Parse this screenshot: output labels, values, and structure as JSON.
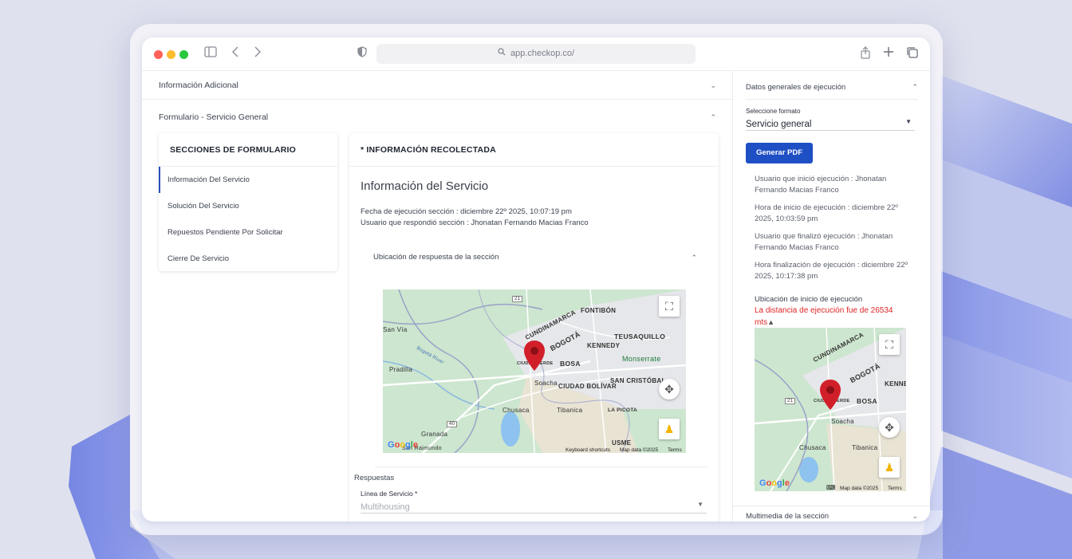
{
  "browser": {
    "url": "app.checkop.co/"
  },
  "main": {
    "accordion_additional": "Información Adicional",
    "accordion_form": "Formulario - Servicio General",
    "sections_card": {
      "title": "SECCIONES DE FORMULARIO",
      "items": [
        "Información Del Servicio",
        "Solución Del Servicio",
        "Repuestos Pendiente Por Solicitar",
        "Cierre De Servicio"
      ]
    },
    "info_card": {
      "title": "* INFORMACIÓN RECOLECTADA",
      "section_title": "Información del Servicio",
      "execution_date": "Fecha de ejecución sección : diciembre 22º 2025, 10:07:19 pm",
      "responder": "Usuario que respondió sección : Jhonatan Fernando Macias Franco",
      "location_label": "Ubicación de respuesta de la sección",
      "responses_label": "Respuestas",
      "field_label": "Línea de Servicio *",
      "field_value": "Multihousing"
    },
    "map1": {
      "labels": [
        "CUNDINAMARCA",
        "BOGOTÁ",
        "FONTIBÓN",
        "TEUSAQUILLO",
        "KENNEDY",
        "BOSA",
        "CIUDAD VERDE",
        "Monserrate",
        "CIUDAD BOLÍVAR",
        "SAN CRISTÓBAL",
        "LA PICOTA",
        "Soacha",
        "Chusaca",
        "Tibanica",
        "Pradilla",
        "Granada",
        "San Raimundo",
        "USME",
        "Bogotá River",
        "San Vía",
        "21",
        "40"
      ],
      "footer_shortcuts": "Keyboard shortcuts",
      "footer_data": "Map data ©2025",
      "footer_terms": "Terms"
    }
  },
  "right_panel": {
    "header": "Datos generales de ejecución",
    "format_label": "Seleccione formato",
    "format_value": "Servicio general",
    "pdf_button": "Generar PDF",
    "start_user": "Usuario que inició ejecución : Jhonatan Fernando Macias Franco",
    "start_time": "Hora de inicio de ejecución : diciembre 22º 2025, 10:03:59 pm",
    "end_user": "Usuario que finalizó ejecución : Jhonatan Fernando Macias Franco",
    "end_time": "Hora finalización de ejecución : diciembre 22º 2025, 10:17:38 pm",
    "start_location": "Ubicación de inicio de ejecución",
    "distance_warning": "La distancia de ejecución fue de 26534 mts",
    "multimedia": "Multimedia de la sección",
    "map2": {
      "labels": [
        "CUNDINAMARCA",
        "BOGOTÁ",
        "KENNE",
        "BOSA",
        "CIUDAD VERDE",
        "Soacha",
        "Chusaca",
        "Tibanica",
        "21"
      ],
      "footer_data": "Map data ©2025",
      "footer_terms": "Terms"
    }
  },
  "colors": {
    "accent": "#1f4fc4",
    "warning": "#e02424",
    "pin": "#d11f2a"
  }
}
